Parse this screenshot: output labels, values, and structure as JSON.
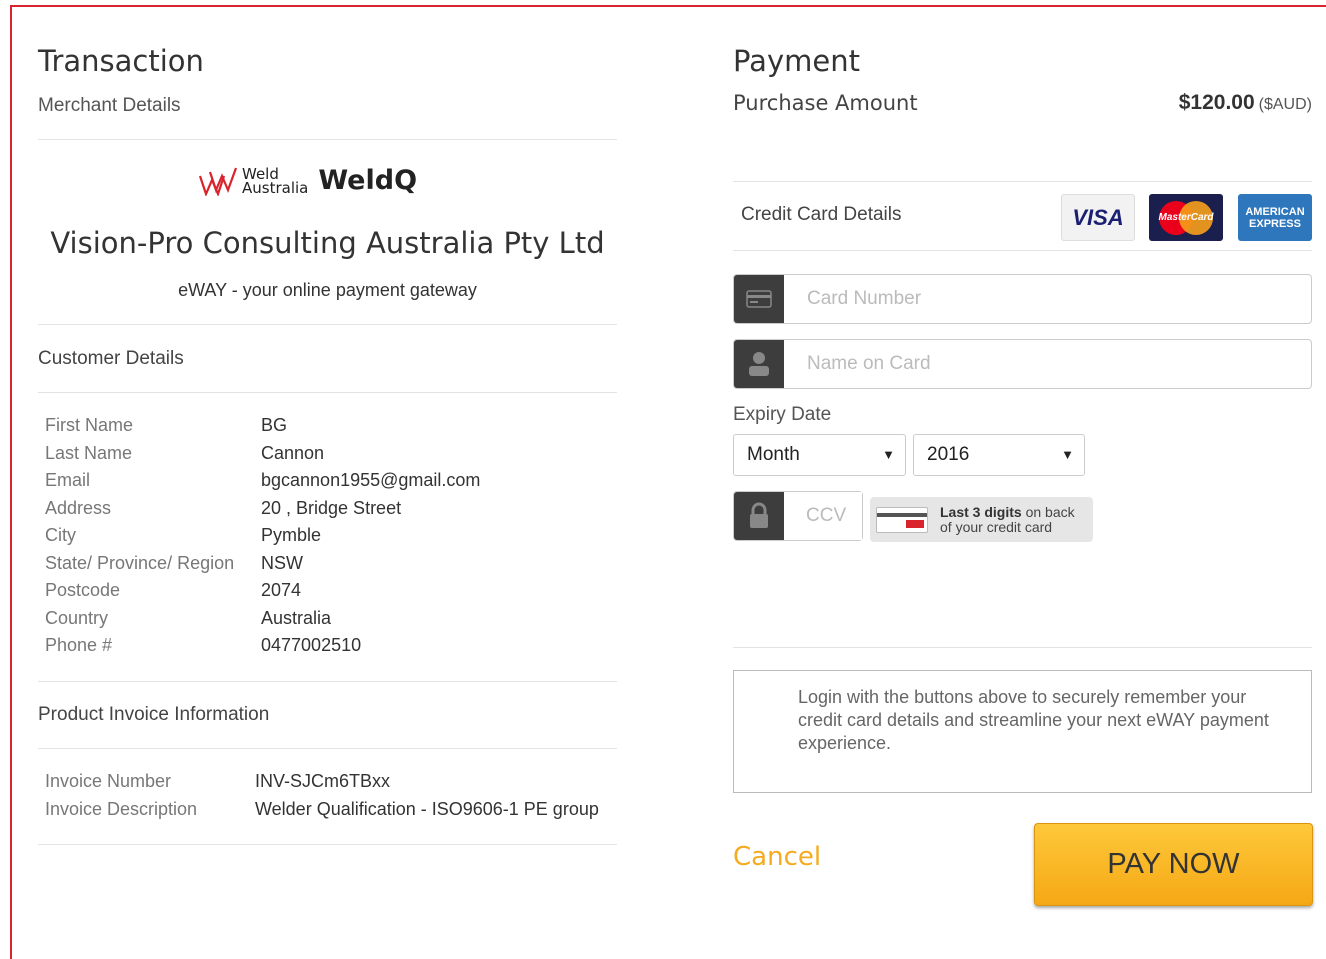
{
  "transaction": {
    "title": "Transaction",
    "merchant_details_label": "Merchant Details",
    "logo": {
      "brand_small": "Weld",
      "brand_small2": "Australia",
      "brand_main": "WeldQ"
    },
    "merchant_name": "Vision-Pro Consulting Australia Pty Ltd",
    "gateway_text": "eWAY - your online payment gateway",
    "customer_details_label": "Customer Details",
    "customer": [
      {
        "label": "First Name",
        "value": "BG"
      },
      {
        "label": "Last Name",
        "value": "Cannon"
      },
      {
        "label": "Email",
        "value": "bgcannon1955@gmail.com"
      },
      {
        "label": "Address",
        "value": "20 , Bridge Street"
      },
      {
        "label": "City",
        "value": "Pymble"
      },
      {
        "label": "State/ Province/ Region",
        "value": "NSW"
      },
      {
        "label": "Postcode",
        "value": "2074"
      },
      {
        "label": "Country",
        "value": "Australia"
      },
      {
        "label": "Phone #",
        "value": "0477002510"
      }
    ],
    "product_invoice_label": "Product Invoice Information",
    "invoice": [
      {
        "label": "Invoice Number",
        "value": "INV-SJCm6TBxx"
      },
      {
        "label": "Invoice Description",
        "value": "Welder Qualification - ISO9606-1 PE group"
      }
    ]
  },
  "payment": {
    "title": "Payment",
    "purchase_amount_label": "Purchase Amount",
    "amount": "$120.00",
    "currency": "($AUD)",
    "credit_card_label": "Credit Card Details",
    "card_logos": {
      "visa": "VISA",
      "mastercard": "MasterCard",
      "amex_line1": "AMERICAN",
      "amex_line2": "EXPRESS"
    },
    "card_number_placeholder": "Card Number",
    "name_on_card_placeholder": "Name on Card",
    "expiry_label": "Expiry Date",
    "month_value": "Month",
    "year_value": "2016",
    "ccv_placeholder": "CCV",
    "ccv_hint_bold": "Last 3 digits",
    "ccv_hint_rest1": " on back",
    "ccv_hint_rest2": "of your credit card",
    "login_note": "Login with the buttons above to securely remember your credit card details and streamline your next eWAY payment experience.",
    "cancel_label": "Cancel",
    "pay_now_label": "PAY NOW"
  },
  "colors": {
    "frame": "#d9232d",
    "accent": "#f5ab1f",
    "button": "#fdc83a"
  }
}
